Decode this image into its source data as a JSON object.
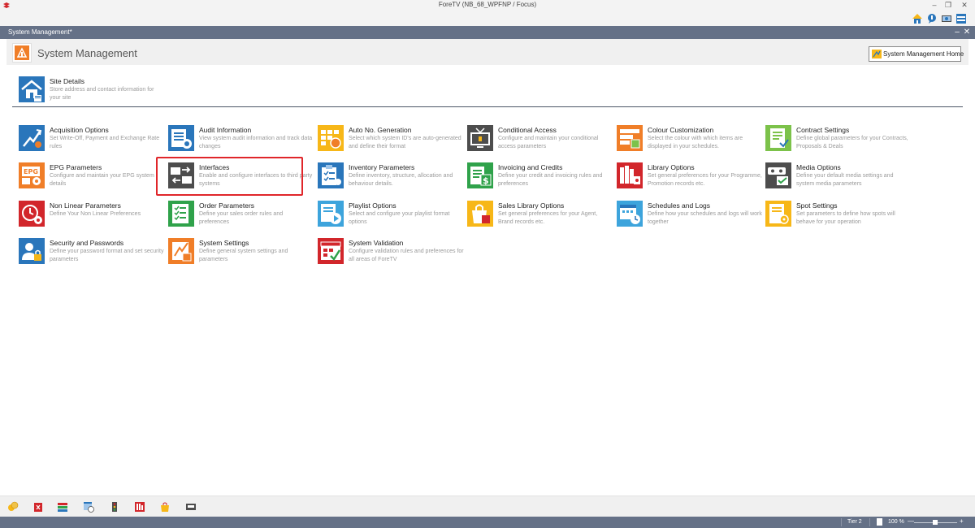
{
  "window": {
    "title": "ForeTV (NB_68_WPFNP / Focus)"
  },
  "module": {
    "tab_title": "System Management*",
    "page_title": "System Management",
    "home_button": "System Management Home"
  },
  "quick_toolbar": [
    "home-icon",
    "chat-icon",
    "display-icon",
    "panel-icon"
  ],
  "items": {
    "site_details": {
      "title": "Site Details",
      "desc": "Store address and contact information for your site"
    },
    "acquisition_options": {
      "title": "Acquisition Options",
      "desc": "Set Write-Off, Payment and Exchange Rate rules"
    },
    "audit_information": {
      "title": "Audit Information",
      "desc": "View system audit information and track data changes"
    },
    "auto_no_generation": {
      "title": "Auto No. Generation",
      "desc": "Select which system ID's are auto-generated and define their format"
    },
    "conditional_access": {
      "title": "Conditional Access",
      "desc": "Configure and maintain your conditional access parameters"
    },
    "colour_customization": {
      "title": "Colour Customization",
      "desc": "Select the colour with which items are displayed in your schedules."
    },
    "contract_settings": {
      "title": "Contract Settings",
      "desc": "Define global parameters for your Contracts, Proposals & Deals"
    },
    "epg_parameters": {
      "title": "EPG Parameters",
      "desc": "Configure and maintain your EPG system details"
    },
    "interfaces": {
      "title": "Interfaces",
      "desc": "Enable and configure interfaces to third party systems"
    },
    "inventory_parameters": {
      "title": "Inventory Parameters",
      "desc": "Define inventory, structure, allocation and behaviour details."
    },
    "invoicing_and_credits": {
      "title": "Invoicing and Credits",
      "desc": "Define your credit and invoicing rules and preferences"
    },
    "library_options": {
      "title": "Library Options",
      "desc": "Set general preferences for your Programme, Promotion records etc."
    },
    "media_options": {
      "title": "Media Options",
      "desc": "Define your default media settings and system media parameters"
    },
    "non_linear_parameters": {
      "title": "Non Linear Parameters",
      "desc": "Define Your Non Linear Preferences"
    },
    "order_parameters": {
      "title": "Order Parameters",
      "desc": "Define your sales order rules and preferences"
    },
    "playlist_options": {
      "title": "Playlist Options",
      "desc": "Select and configure your playlist format options"
    },
    "sales_library_options": {
      "title": "Sales Library Options",
      "desc": "Set general preferences for your Agent, Brand records etc."
    },
    "schedules_and_logs": {
      "title": "Schedules and Logs",
      "desc": "Define how your schedules and logs will work together"
    },
    "spot_settings": {
      "title": "Spot Settings",
      "desc": "Set parameters to define how spots will behave for your operation"
    },
    "security_and_passwords": {
      "title": "Security and Passwords",
      "desc": "Define your password format and set security parameters"
    },
    "system_settings": {
      "title": "System Settings",
      "desc": "Define general system settings and parameters"
    },
    "system_validation": {
      "title": "System Validation",
      "desc": "Configure validation rules and preferences for all areas of ForeTV"
    }
  },
  "taskbar": [
    "coins-icon",
    "delete-icon",
    "books-icon",
    "calendar-clock-icon",
    "traffic-light-icon",
    "library-icon",
    "shopping-bag-icon",
    "media-tape-icon"
  ],
  "status": {
    "tier": "Tier 2",
    "zoom": "100 %",
    "zoom_minus": "—",
    "zoom_plus": "+"
  },
  "colors": {
    "header_bar": "#657187",
    "orange": "#F07E28",
    "blue": "#2A76BB",
    "green": "#2FA24A",
    "yellow": "#F7B718",
    "red": "#D2262B",
    "gray": "#4D4D4D",
    "lightgreen": "#7CC24A",
    "highlight": "#E0262A"
  }
}
